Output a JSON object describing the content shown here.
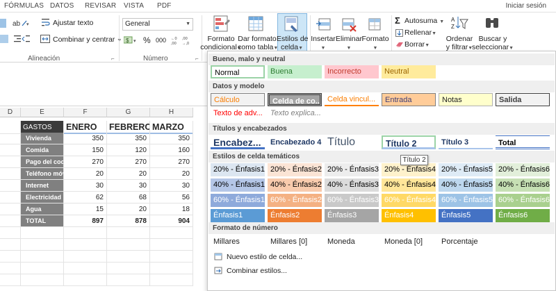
{
  "tabs": [
    "FÓRMULAS",
    "DATOS",
    "REVISAR",
    "VISTA",
    "PDF"
  ],
  "signin": "Iniciar sesión",
  "ribbon": {
    "wrap_text": "Ajustar texto",
    "merge_center": "Combinar y centrar",
    "alignment_label": "Alineación",
    "number_format_value": "General",
    "currency": "$",
    "percent": "%",
    "thousands": "000",
    "number_label": "Número",
    "conditional_format": [
      "Formato",
      "condicional"
    ],
    "format_as_table": [
      "Dar formato",
      "como tabla"
    ],
    "cell_styles": [
      "Estilos de",
      "celda"
    ],
    "insert": "Insertar",
    "delete": "Eliminar",
    "format": "Formato",
    "autosum": "Autosuma",
    "fill": "Rellenar",
    "clear": "Borrar",
    "sort_filter": [
      "Ordenar",
      "y filtrar"
    ],
    "find_select": [
      "Buscar y",
      "seleccionar"
    ]
  },
  "sheet": {
    "columns": [
      "D",
      "E",
      "F",
      "G",
      "H"
    ],
    "header": {
      "label": "GASTOS",
      "months": [
        "ENERO",
        "FEBRERO",
        "MARZO"
      ]
    },
    "rows": [
      {
        "label": "Vivienda",
        "values": [
          "350",
          "350",
          "350"
        ]
      },
      {
        "label": "Comida",
        "values": [
          "150",
          "120",
          "160"
        ]
      },
      {
        "label": "Pago del coche",
        "values": [
          "270",
          "270",
          "270"
        ]
      },
      {
        "label": "Teléfono móvil",
        "values": [
          "20",
          "20",
          "20"
        ]
      },
      {
        "label": "Internet",
        "values": [
          "30",
          "30",
          "30"
        ]
      },
      {
        "label": "Electricidad",
        "values": [
          "62",
          "68",
          "56"
        ]
      },
      {
        "label": "Agua",
        "values": [
          "15",
          "20",
          "18"
        ]
      }
    ],
    "total": {
      "label": "TOTAL",
      "values": [
        "897",
        "878",
        "904"
      ]
    }
  },
  "gallery": {
    "sections": [
      "Bueno, malo y neutral",
      "Datos y modelo",
      "Títulos y encabezados",
      "Estilos de celda temáticos",
      "Formato de número"
    ],
    "good_bad": [
      "Normal",
      "Buena",
      "Incorrecto",
      "Neutral"
    ],
    "data_model_1": [
      "Cálculo",
      "Celda de co...",
      "Celda vincul...",
      "Entrada",
      "Notas",
      "Salida"
    ],
    "data_model_2": [
      "Texto de adv...",
      "Texto explica..."
    ],
    "titles": [
      "Encabez...",
      "Encabezado 4",
      "Título",
      "Título 2",
      "Título 3",
      "Total"
    ],
    "theme_rows": [
      [
        "20% - Énfasis1",
        "20% - Énfasis2",
        "20% - Énfasis3",
        "20% - Énfasis4",
        "20% - Énfasis5",
        "20% - Énfasis6"
      ],
      [
        "40% - Énfasis1",
        "40% - Énfasis2",
        "40% - Énfasis3",
        "40% - Énfasis4",
        "40% - Énfasis5",
        "40% - Énfasis6"
      ],
      [
        "60% - Énfasis1",
        "60% - Énfasis2",
        "60% - Énfasis3",
        "60% - Énfasis4",
        "60% - Énfasis5",
        "60% - Énfasis6"
      ],
      [
        "Énfasis1",
        "Énfasis2",
        "Énfasis3",
        "Énfasis4",
        "Énfasis5",
        "Énfasis6"
      ]
    ],
    "number_formats": [
      "Millares",
      "Millares [0]",
      "Moneda",
      "Moneda [0]",
      "Porcentaje"
    ],
    "new_style": "Nuevo estilo de celda...",
    "merge_styles": "Combinar estilos...",
    "tooltip": "Título 2"
  }
}
